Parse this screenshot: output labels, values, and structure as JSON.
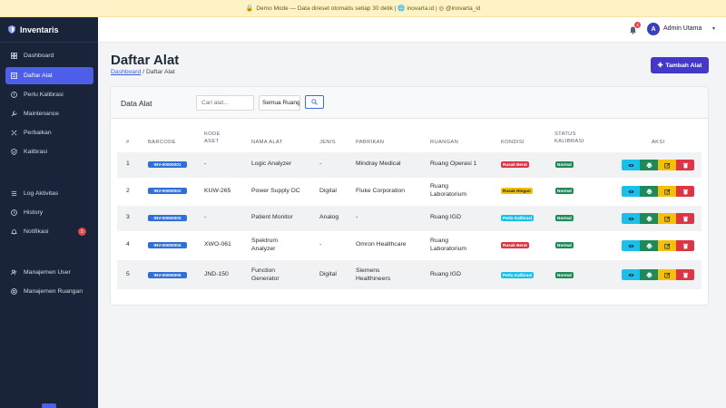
{
  "banner": {
    "text": "Demo Mode — Data direset otomatis setiap 30 detik | 🌐 inovarta.id | ◎ @inovarta_id"
  },
  "sidebar": {
    "brand": "Inventaris",
    "items": [
      {
        "label": "Dashboard",
        "icon": "grid-icon"
      },
      {
        "label": "Daftar Alat",
        "icon": "list-icon",
        "active": true
      },
      {
        "label": "Perlu Kalibrasi",
        "icon": "alert-circle-icon"
      },
      {
        "label": "Maintenance",
        "icon": "wrench-icon"
      },
      {
        "label": "Perbaikan",
        "icon": "tools-icon"
      },
      {
        "label": "Kalibrasi",
        "icon": "shield-check-icon"
      },
      {
        "label": "Log Aktivitas",
        "icon": "list-lines-icon"
      },
      {
        "label": "History",
        "icon": "clock-icon"
      },
      {
        "label": "Notifikasi",
        "icon": "bell-icon",
        "badge": "5"
      },
      {
        "label": "Manajemen User",
        "icon": "users-icon"
      },
      {
        "label": "Manajemen Ruangan",
        "icon": "building-icon"
      }
    ]
  },
  "topbar": {
    "notif_count": "4",
    "avatar_initial": "A",
    "user_name": "Admin Utama"
  },
  "page": {
    "title": "Daftar Alat",
    "breadcrumb": {
      "home": "Dashboard",
      "separator": "/",
      "current": "Daftar Alat"
    },
    "add_button": "Tambah Alat"
  },
  "card": {
    "title": "Data Alat",
    "search_placeholder": "Cari alat...",
    "filter_value": "Semua Ruang"
  },
  "table": {
    "headers": [
      "#",
      "BARCODE",
      "KODE ASET",
      "NAMA ALAT",
      "JENIS",
      "PABRIKAN",
      "RUANGAN",
      "KONDISI",
      "STATUS KALIBRASI",
      "AKSI"
    ],
    "rows": [
      {
        "no": "1",
        "barcode": "INV-00000001",
        "kode": "-",
        "nama": "Logic Analyzer",
        "jenis": "-",
        "pabrikan": "Mindray Medical",
        "ruangan": "Ruang Operasi 1",
        "kondisi": "Rusak Berat",
        "status": "Normal"
      },
      {
        "no": "2",
        "barcode": "INV-00000002",
        "kode": "KUW-265",
        "nama": "Power Supply DC",
        "jenis": "Digital",
        "pabrikan": "Fluke Corporation",
        "ruangan": "Ruang Laboratorium",
        "kondisi": "Rusak Ringan",
        "status": "Normal"
      },
      {
        "no": "3",
        "barcode": "INV-00000003",
        "kode": "-",
        "nama": "Patient Monitor",
        "jenis": "Analog",
        "pabrikan": "-",
        "ruangan": "Ruang IGD",
        "kondisi": "Perlu Kalibrasi",
        "status": "Normal"
      },
      {
        "no": "4",
        "barcode": "INV-00000004",
        "kode": "XWO-061",
        "nama": "Spektrum Analyzer",
        "jenis": "-",
        "pabrikan": "Omron Healthcare",
        "ruangan": "Ruang Laboratorium",
        "kondisi": "Rusak Berat",
        "status": "Normal"
      },
      {
        "no": "5",
        "barcode": "INV-00000005",
        "kode": "JND-150",
        "nama": "Function Generator",
        "jenis": "Digital",
        "pabrikan": "Siemens Healthineers",
        "ruangan": "Ruang IGD",
        "kondisi": "Perlu Kalibrasi",
        "status": "Normal"
      }
    ]
  },
  "colors": {
    "sidebar_bg": "#19243b",
    "accent": "#4d5ee8",
    "primary_button": "#4338ca",
    "rusak_berat": "#dc3545",
    "rusak_ringan": "#f4c00c",
    "perlu_kalibrasi": "#1bc0ea",
    "normal": "#1f8a57"
  }
}
